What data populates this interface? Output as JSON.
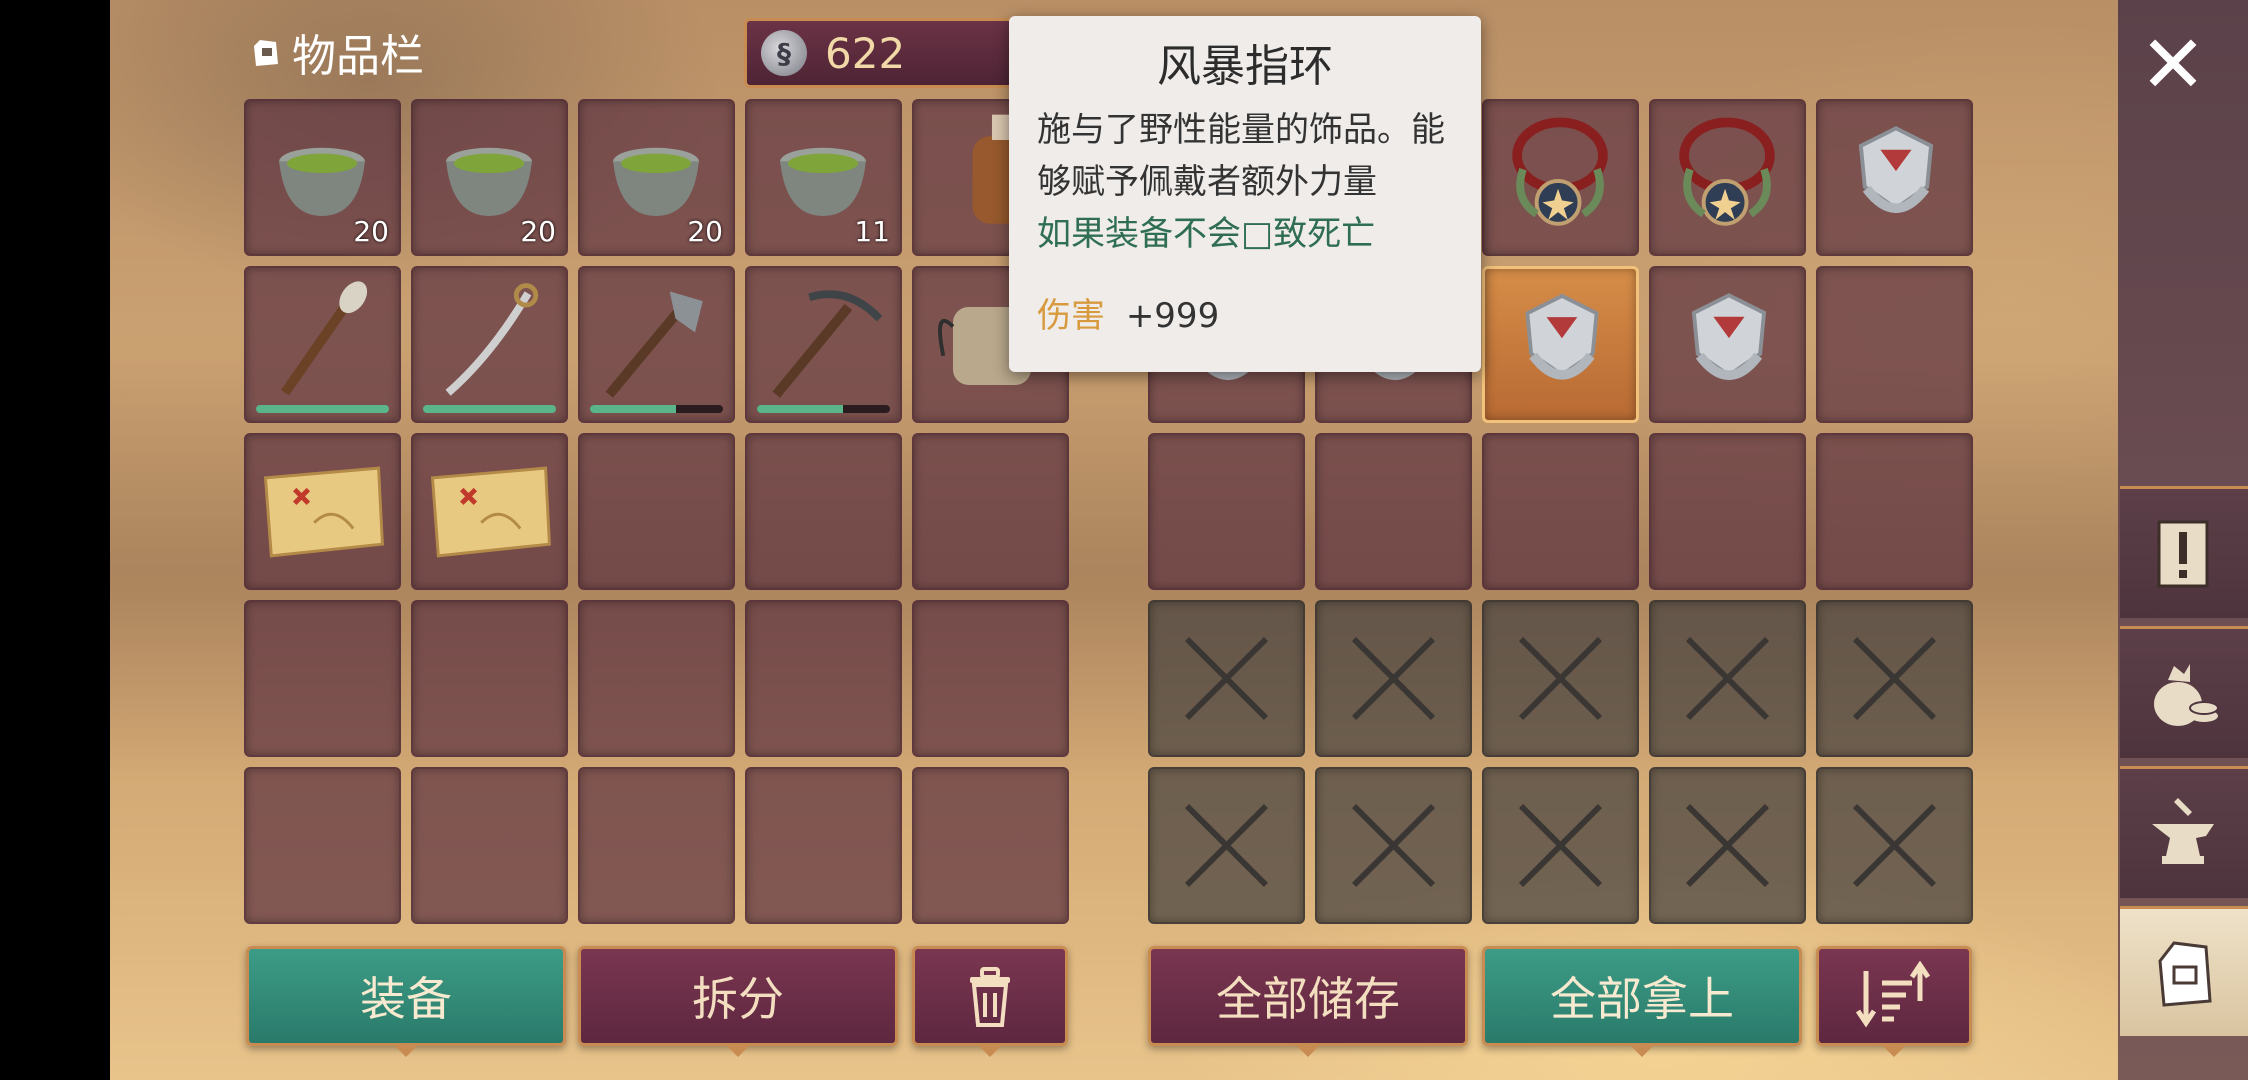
{
  "inventory": {
    "title": "物品栏",
    "currency_value": "622",
    "left_slots": [
      {
        "item": "bowl-icon",
        "count": "20"
      },
      {
        "item": "bowl-icon",
        "count": "20"
      },
      {
        "item": "bowl-icon",
        "count": "20"
      },
      {
        "item": "bowl-icon",
        "count": "11"
      },
      {
        "item": "bottle-icon",
        "count": ""
      },
      {
        "item": "torch-icon",
        "durability": 1.0
      },
      {
        "item": "sword-icon",
        "durability": 1.0
      },
      {
        "item": "axe-icon",
        "durability": 0.65
      },
      {
        "item": "pickaxe-icon",
        "durability": 0.65
      },
      {
        "item": "gauntlet-icon"
      },
      {
        "item": "map-icon"
      },
      {
        "item": "map-icon"
      },
      {},
      {},
      {},
      {},
      {},
      {},
      {},
      {},
      {},
      {},
      {},
      {},
      {}
    ],
    "right_slots": [
      {},
      {},
      {
        "item": "amulet-icon"
      },
      {
        "item": "amulet-icon"
      },
      {
        "item": "ring-icon"
      },
      {
        "item": "ring-icon"
      },
      {
        "item": "ring-icon"
      },
      {
        "item": "ring-icon",
        "selected": true
      },
      {
        "item": "ring-icon"
      },
      {},
      {},
      {},
      {},
      {},
      {},
      {
        "locked": true
      },
      {
        "locked": true
      },
      {
        "locked": true
      },
      {
        "locked": true
      },
      {
        "locked": true
      },
      {
        "locked": true
      },
      {
        "locked": true
      },
      {
        "locked": true
      },
      {
        "locked": true
      },
      {
        "locked": true
      }
    ]
  },
  "tooltip": {
    "title": "风暴指环",
    "desc_line1": "施与了野性能量的饰品。能",
    "desc_line2": "够赋予佩戴者额外力量",
    "warning": "如果装备不会□致死亡",
    "stat_label": "伤害",
    "stat_value": "+999"
  },
  "buttons": {
    "equip": "装备",
    "split": "拆分",
    "store_all": "全部储存",
    "take_all": "全部拿上"
  },
  "colors": {
    "accent": "#c88c52",
    "green_button": "#3c9c86",
    "purple_button": "#6b2e45",
    "selected_slot": "#d68d48"
  }
}
